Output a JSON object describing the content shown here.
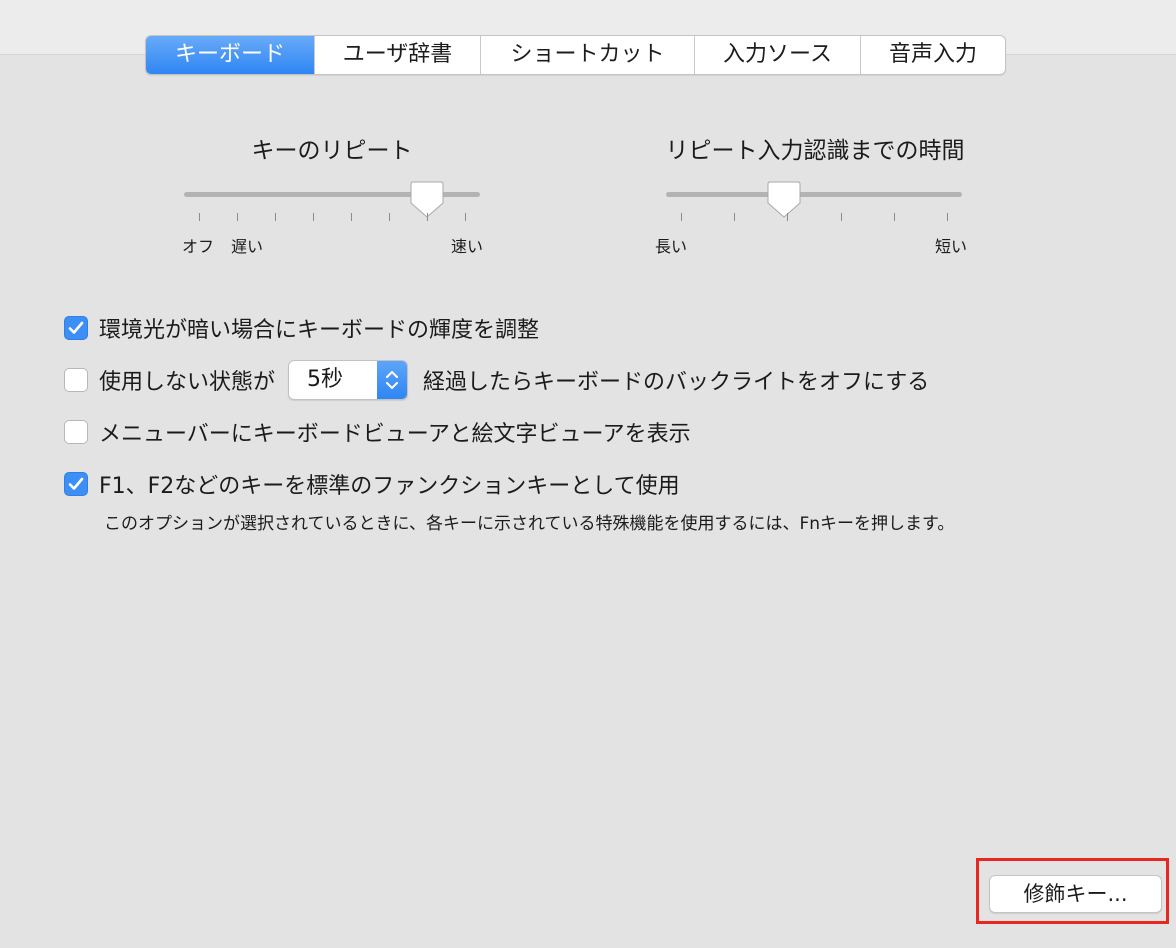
{
  "tabs": [
    {
      "label": "キーボード",
      "active": true
    },
    {
      "label": "ユーザ辞書",
      "active": false
    },
    {
      "label": "ショートカット",
      "active": false
    },
    {
      "label": "入力ソース",
      "active": false
    },
    {
      "label": "音声入力",
      "active": false
    }
  ],
  "key_repeat": {
    "title": "キーのリピート",
    "label_off": "オフ",
    "label_slow": "遅い",
    "label_fast": "速い",
    "level": 0.82
  },
  "repeat_delay": {
    "title": "リピート入力認識までの時間",
    "label_long": "長い",
    "label_short": "短い",
    "level": 0.4
  },
  "options": {
    "auto_brightness": {
      "checked": true,
      "label": "環境光が暗い場合にキーボードの輝度を調整"
    },
    "backlight_off": {
      "checked": false,
      "label_before": "使用しない状態が",
      "popup_value": "5秒",
      "label_after": "経過したらキーボードのバックライトをオフにする"
    },
    "show_viewers": {
      "checked": false,
      "label": "メニューバーにキーボードビューアと絵文字ビューアを表示"
    },
    "fn_keys": {
      "checked": true,
      "label": "F1、F2などのキーを標準のファンクションキーとして使用",
      "note": "このオプションが選択されているときに、各キーに示されている特殊機能を使用するには、Fnキーを押します。"
    }
  },
  "modifier_button_label": "修飾キー...",
  "colors": {
    "accent": "#3d8ff6",
    "highlight": "#e8281f",
    "background": "#e3e3e3"
  }
}
